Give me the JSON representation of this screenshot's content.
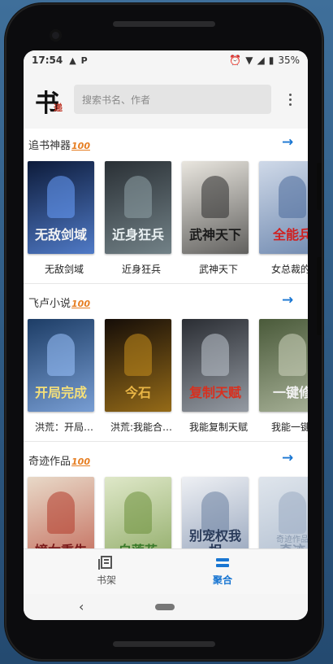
{
  "status_bar": {
    "time": "17:54",
    "p_badge": "P",
    "battery": "35%"
  },
  "app_bar": {
    "logo_main": "书",
    "logo_sub": "递",
    "search_placeholder": "搜索书名、作者"
  },
  "sections": [
    {
      "title": "追书神器",
      "badge": "100",
      "books": [
        {
          "name": "无敌剑域",
          "cover_text": "无敌剑域",
          "bg": "#0d1b3a",
          "accent": "#6aa0ff",
          "text_color": "#f2f2f2"
        },
        {
          "name": "近身狂兵",
          "cover_text": "近身狂兵",
          "bg": "#2a3035",
          "accent": "#8fa2a8",
          "text_color": "#e9f0f2"
        },
        {
          "name": "武神天下",
          "cover_text": "武神天下",
          "bg": "#e9e6df",
          "accent": "#2b2b2b",
          "text_color": "#1a1a1a"
        },
        {
          "name": "女总裁的全",
          "cover_text": "全能兵",
          "bg": "#cfd9e8",
          "accent": "#4a6a9a",
          "text_color": "#d02020"
        }
      ]
    },
    {
      "title": "飞卢小说",
      "badge": "100",
      "books": [
        {
          "name": "洪荒：开局…",
          "cover_text": "开局完成",
          "bg": "#1d3d66",
          "accent": "#9cc4ff",
          "text_color": "#f5e07a"
        },
        {
          "name": "洪荒:我能合…",
          "cover_text": "今石",
          "bg": "#150d08",
          "accent": "#c8901e",
          "text_color": "#e9b545"
        },
        {
          "name": "我能复制天赋",
          "cover_text": "复制天赋",
          "bg": "#2a2d33",
          "accent": "#bfc6cf",
          "text_color": "#d8301f"
        },
        {
          "name": "我能一键修",
          "cover_text": "一键修",
          "bg": "#4a5a3a",
          "accent": "#cfd6bf",
          "text_color": "#f2f2f2"
        }
      ]
    },
    {
      "title": "奇迹作品",
      "badge": "100",
      "books": [
        {
          "name": "",
          "cover_text": "嫡女重生",
          "bg": "#e8d9c8",
          "accent": "#b33a2a",
          "text_color": "#7a1a1a"
        },
        {
          "name": "",
          "cover_text": "白莲花",
          "bg": "#dfe8c9",
          "accent": "#6b8f3a",
          "text_color": "#3a7a2a"
        },
        {
          "name": "",
          "cover_text": "别宠权我相",
          "bg": "#eef0f4",
          "accent": "#6a7fa0",
          "text_color": "#2a3b5a"
        },
        {
          "name": "",
          "cover_text": "奇迹",
          "bg": "#dfe5ec",
          "accent": "#9aabc2",
          "text_color": "#8a9ab0"
        }
      ]
    }
  ],
  "fourth_cover_caption": "奇迹作品",
  "bottom_nav": {
    "shelf_label": "书架",
    "aggregate_label": "聚合"
  },
  "colors": {
    "accent": "#1976d2",
    "badge": "#e67e22"
  }
}
